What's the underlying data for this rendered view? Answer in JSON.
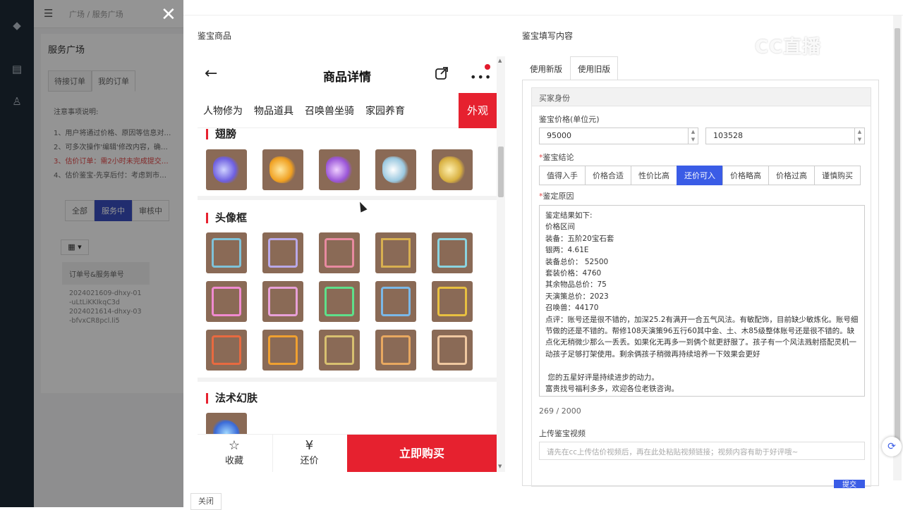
{
  "left_panel": {
    "breadcrumb": "广场 / 服务广场",
    "page_title": "服务广场",
    "tabs": [
      "待接订单",
      "我的订单"
    ],
    "notes_title": "注意事项说明:",
    "notes": [
      "1、用户将通过价格、原因等信息对…",
      "2、可多次操作'编辑'修改内容，确…",
      "3、估价订单：需2小时未完成提交…",
      "4、估价鉴宝-先享后付：考虑到市…"
    ],
    "filters": [
      "全部",
      "服务中",
      "审核中"
    ],
    "table_header": "订单号&服务单号",
    "table_rows": [
      "2024021609-dhxy-01-uLtLiKKIkqC3d",
      "2024021614-dhxy-03-bfvxCR8pcl.li5"
    ]
  },
  "drawer": {
    "left_section_title": "鉴宝商品",
    "right_section_title": "鉴宝填写内容",
    "close_label": "关闭"
  },
  "phone": {
    "title": "商品详情",
    "tabs": [
      "人物修为",
      "物品道具",
      "召唤兽坐骑",
      "家园养育",
      "外观"
    ],
    "categories": [
      "翅膀",
      "头像框",
      "法术幻肤"
    ],
    "footer": {
      "favorite": "收藏",
      "bargain": "还价",
      "buy": "立即购买"
    }
  },
  "form": {
    "tabs": [
      "使用新版",
      "使用旧版"
    ],
    "box_header": "买家身份",
    "price_label": "鉴宝价格(单位元)",
    "price_min": "95000",
    "price_max": "103528",
    "conclusion_label": "鉴宝结论",
    "conclusions": [
      "值得入手",
      "价格合适",
      "性价比高",
      "还价可入",
      "价格略高",
      "价格过高",
      "谨慎购买"
    ],
    "selected_conclusion": "还价可入",
    "reason_label": "鉴定原因",
    "reason_text": "鉴定结果如下:\n价格区间\n装备：五阶20宝石套\n银两：4.61E\n装备总价： 52500\n套装价格：4760\n其余物品总价：75\n天演策总价：2023\n召唤兽：44170\n点评：账号还是很不错的，加深25.2有满开一合五气风法。有敏配饰，目前缺少敏炼化。账号细节做的还是不错的。帮修108天演策96五行60其中金、土、木85级整体账号还是很不错的。缺点化无稍微少那么一丢丢。如果化无再多一到俩个就更舒服了。孩子有一个风法溅射搭配灵机一动孩子足够打架使用。剩余俩孩子稍微再持续培养一下效果会更好\n\n 您的五星好评是持续进步的动力。\n富贵找号福利多多，欢迎各位老铁咨询。",
    "char_count": "269 / 2000",
    "video_label": "上传鉴宝视频",
    "video_placeholder": "请先在cc上传估价视频后，再在此处粘贴视频链接；视频内容有助于好评哦~",
    "submit_label": "提交"
  },
  "watermark": "CC直播",
  "colors": {
    "accent_red": "#e6212f",
    "accent_blue": "#3a5ce6"
  }
}
